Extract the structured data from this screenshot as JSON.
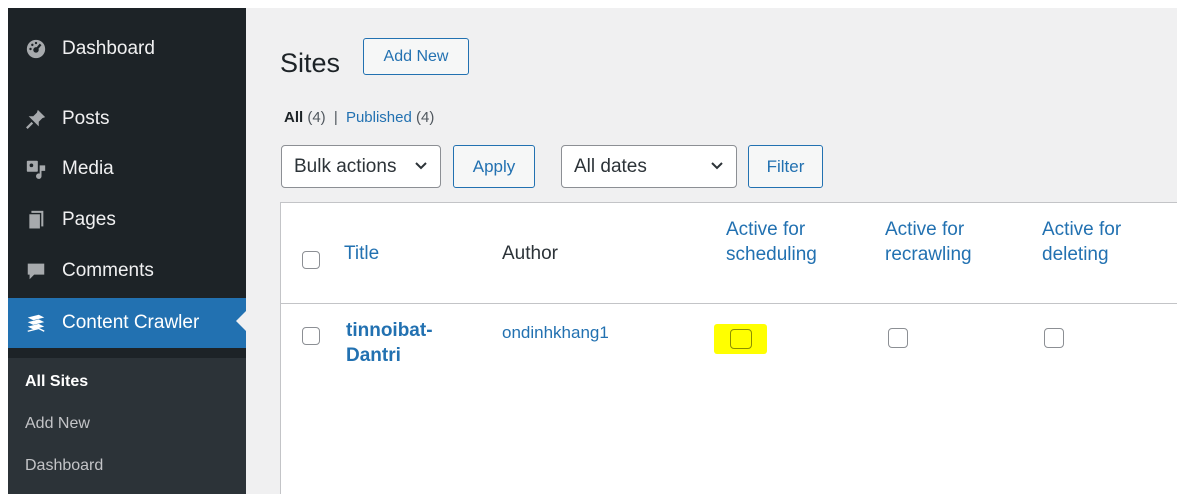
{
  "sidebar": {
    "items": [
      {
        "label": "Dashboard",
        "icon": "dashboard-icon"
      },
      {
        "label": "Posts",
        "icon": "pushpin-icon"
      },
      {
        "label": "Media",
        "icon": "media-icon"
      },
      {
        "label": "Pages",
        "icon": "pages-icon"
      },
      {
        "label": "Comments",
        "icon": "comments-icon"
      },
      {
        "label": "Content Crawler",
        "icon": "content-crawler-icon"
      }
    ],
    "submenu": [
      "All Sites",
      "Add New",
      "Dashboard"
    ]
  },
  "page": {
    "title": "Sites",
    "add_new": "Add New"
  },
  "filters": {
    "all_label": "All",
    "all_count": "(4)",
    "separator": "|",
    "published_label": "Published",
    "published_count": "(4)"
  },
  "toolbar": {
    "bulk_actions": "Bulk actions",
    "apply": "Apply",
    "dates": "All dates",
    "filter": "Filter"
  },
  "table": {
    "columns": {
      "title": "Title",
      "author": "Author",
      "scheduling_1": "Active for",
      "scheduling_2": "scheduling",
      "recrawling_1": "Active for",
      "recrawling_2": "recrawling",
      "deleting_1": "Active for",
      "deleting_2": "deleting"
    },
    "rows": [
      {
        "title_1": "tinnoibat-",
        "title_2": "Dantri",
        "author": "ondinhkhang1",
        "scheduling": false,
        "recrawling": false,
        "deleting": false
      }
    ]
  },
  "colors": {
    "sidebar_bg": "#1d2327",
    "accent": "#2271b1",
    "highlight": "#ffff00"
  }
}
